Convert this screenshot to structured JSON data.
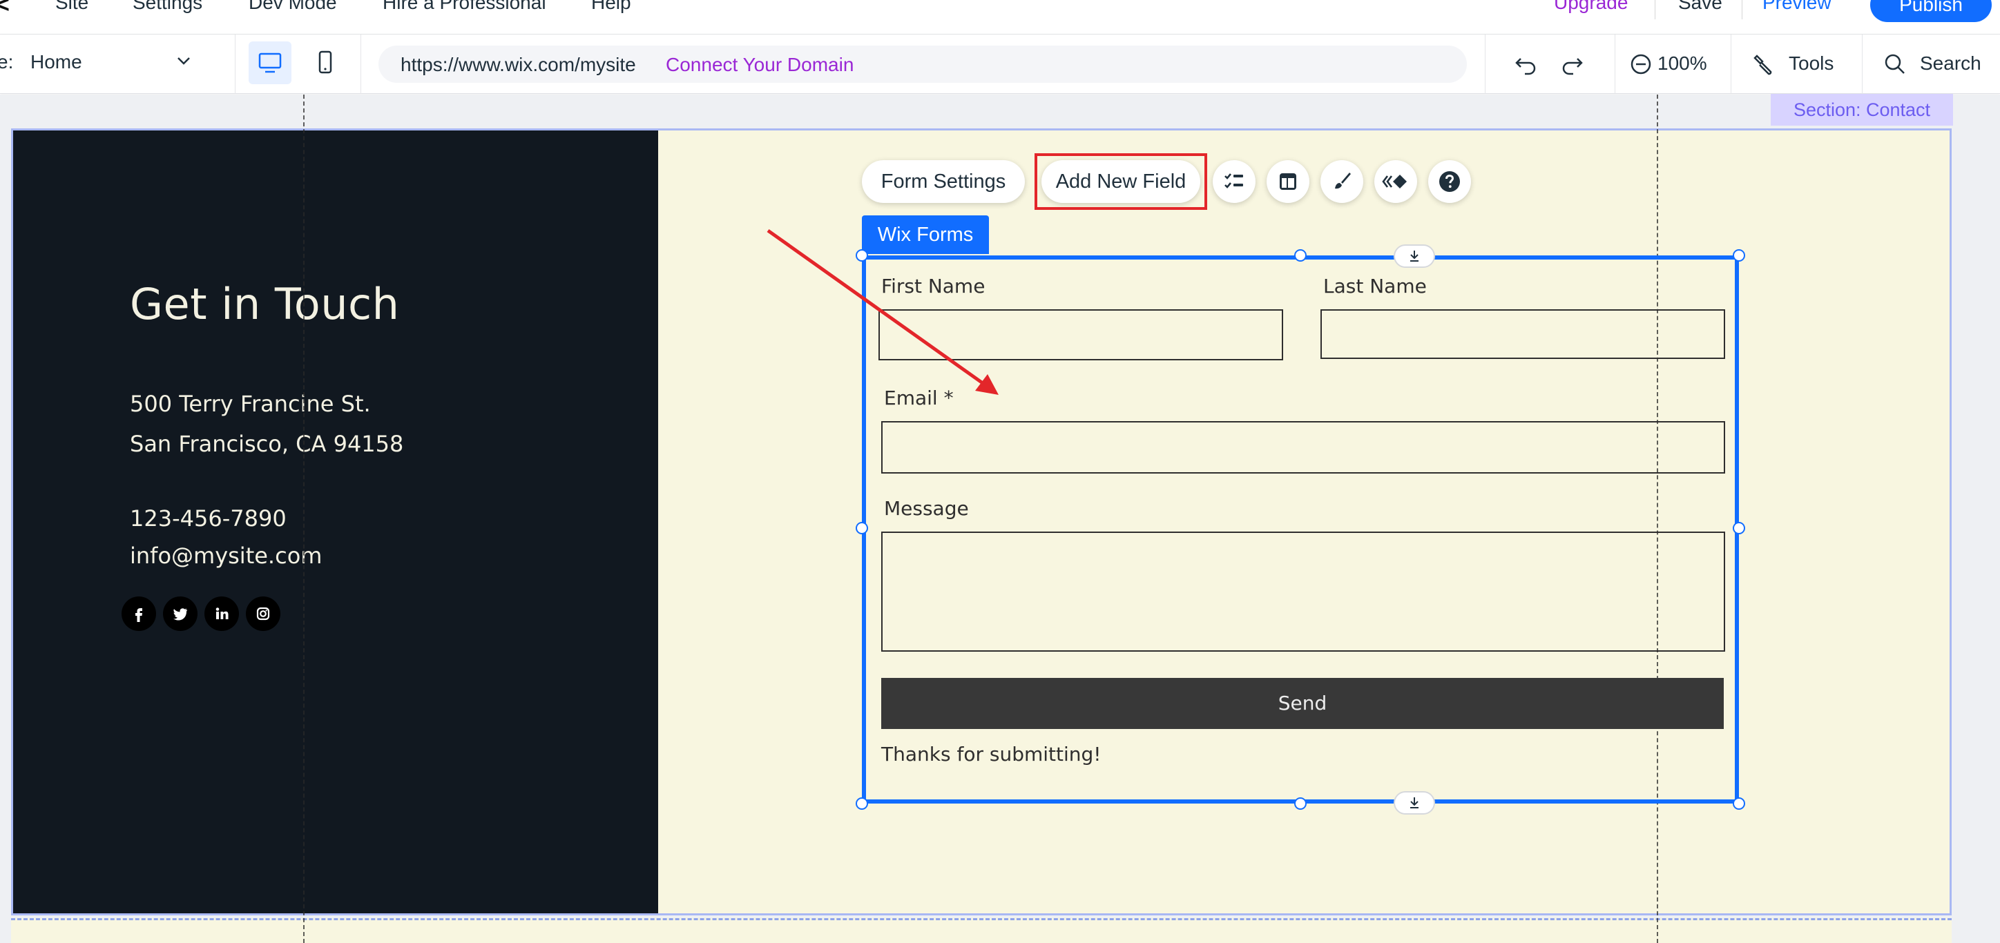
{
  "menu": {
    "items": [
      "Site",
      "Settings",
      "Dev Mode",
      "Hire a Professional",
      "Help"
    ],
    "upgrade": "Upgrade",
    "save": "Save",
    "preview": "Preview",
    "publish": "Publish"
  },
  "toolbar": {
    "page_label": "e:",
    "page_value": "Home",
    "url": "https://www.wix.com/mysite",
    "connect_domain": "Connect Your Domain",
    "zoom": "100%",
    "tools": "Tools",
    "search": "Search"
  },
  "section": {
    "tag": "Section: Contact"
  },
  "contact": {
    "title": "Get in Touch",
    "address_line1": "500 Terry Francine St.",
    "address_line2": "San Francisco, CA 94158",
    "phone": "123-456-7890",
    "email": "info@mysite.com",
    "social_icons": [
      "facebook-icon",
      "twitter-icon",
      "linkedin-icon",
      "instagram-icon"
    ]
  },
  "form_toolbar": {
    "form_settings": "Form Settings",
    "add_new_field": "Add New Field",
    "icons": [
      "checklist-icon",
      "layout-icon",
      "design-brush-icon",
      "animation-icon",
      "help-icon"
    ]
  },
  "form": {
    "tab_label": "Wix Forms",
    "first_name_label": "First Name",
    "last_name_label": "Last Name",
    "email_label": "Email *",
    "message_label": "Message",
    "send_label": "Send",
    "thanks_text": "Thanks for submitting!"
  },
  "colors": {
    "accent": "#116dff",
    "brand_purple": "#9a27d5",
    "highlight_red": "#e3262a",
    "dark_panel": "#111820",
    "section_bg": "#f8f6e0"
  }
}
